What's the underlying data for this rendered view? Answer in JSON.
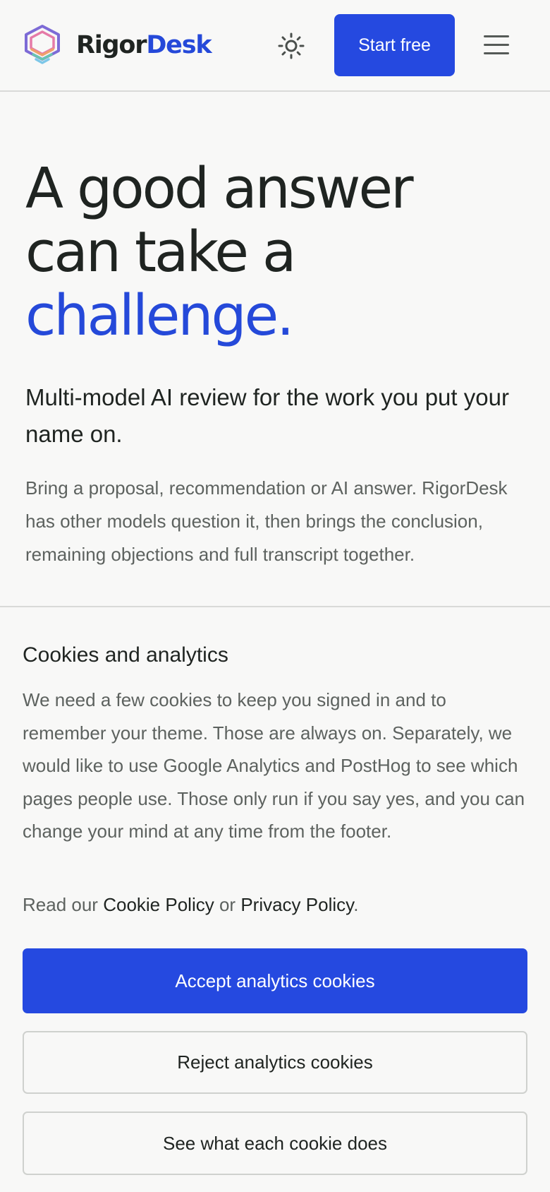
{
  "header": {
    "brand_part1": "Rigor",
    "brand_part2": "Desk",
    "start_label": "Start free"
  },
  "hero": {
    "title_line1": "A good answer",
    "title_line2": "can take a",
    "title_accent": "challenge.",
    "subhead": "Multi-model AI review for the work you put your name on.",
    "body": "Bring a proposal, recommendation or AI answer. RigorDesk has other models question it, then brings the conclusion, remaining objections and full transcript together."
  },
  "cookie_banner": {
    "title": "Cookies and analytics",
    "text": "We need a few cookies to keep you signed in and to remember your theme. Those are always on. Separately, we would like to use Google Analytics and PostHog to see which pages people use. Those only run if you say yes, and you can change your mind at any time from the footer.",
    "read_prefix": "Read our",
    "cookie_policy_link": "Cookie Policy",
    "or_text": "or",
    "privacy_policy_link": "Privacy Policy",
    "period": ".",
    "accept_label": "Accept analytics cookies",
    "reject_label": "Reject analytics cookies",
    "details_label": "See what each cookie does"
  },
  "colors": {
    "accent": "#2549e0",
    "text": "#1f2421",
    "muted": "#5d625f",
    "background": "#f8f8f7",
    "border": "#d9dad8"
  },
  "icons": {
    "logo": "rigordesk-logo-icon",
    "theme": "sun-icon",
    "menu": "hamburger-menu-icon"
  }
}
